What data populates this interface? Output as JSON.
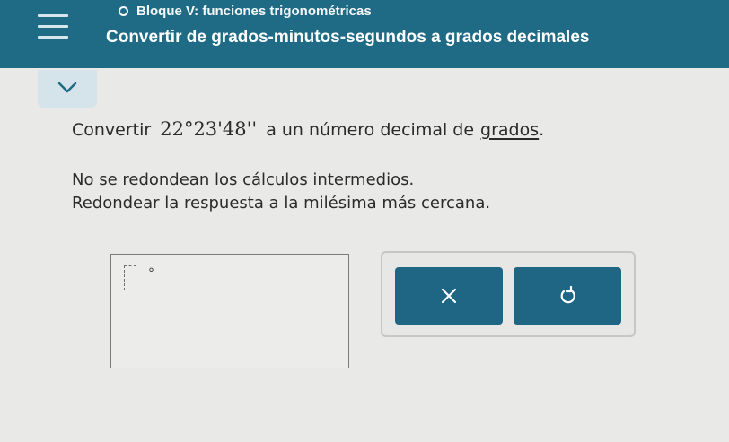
{
  "header": {
    "section_label": "Bloque V: funciones trigonométricas",
    "topic_title": "Convertir de grados-minutos-segundos a grados decimales",
    "menu_icon": "hamburger-menu-icon",
    "status_icon": "circle-status-icon",
    "background_color": "#1f6b86"
  },
  "collapse": {
    "icon": "chevron-down-icon"
  },
  "question": {
    "prefix": "Convertir",
    "expression": "22°23'48''",
    "middle": "a un número decimal de",
    "link_text": "grados",
    "suffix": "."
  },
  "instructions": {
    "line1": "No se redondean los cálculos intermedios.",
    "line2": "Redondear la respuesta a la milésima más cercana."
  },
  "answer": {
    "value": "",
    "unit_symbol": "°"
  },
  "tools": {
    "clear_icon": "x-icon",
    "undo_icon": "undo-icon",
    "button_color": "#1f6685"
  }
}
